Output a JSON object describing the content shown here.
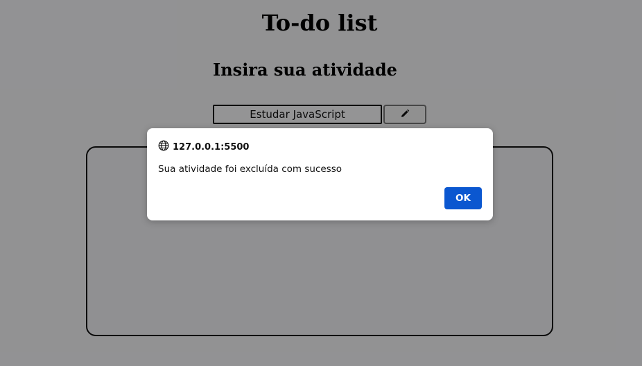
{
  "page": {
    "title": "To-do list",
    "section_title": "Insira sua atividade"
  },
  "form": {
    "activity_value": "Estudar JavaScript",
    "edit_button_icon": "pencil-icon"
  },
  "task_list": {
    "items": []
  },
  "dialog": {
    "origin_icon": "globe-icon",
    "origin": "127.0.0.1:5500",
    "message": "Sua atividade foi excluída com sucesso",
    "ok_label": "OK",
    "ok_color": "#0b57d0"
  },
  "colors": {
    "overlay": "rgba(0,0,0,0.40)",
    "page_background": "#f4f4f6"
  }
}
